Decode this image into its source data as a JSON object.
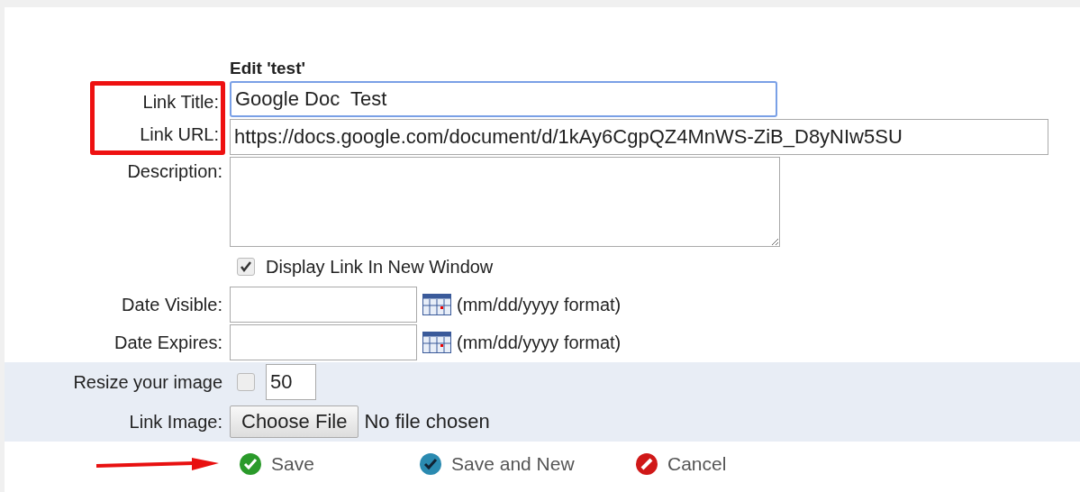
{
  "heading": "Edit 'test'",
  "highlighted_labels": [
    "Link Title:",
    "Link URL:"
  ],
  "link_title": {
    "value": "Google Doc  Test",
    "focused": true
  },
  "link_url": {
    "value": "https://docs.google.com/document/d/1kAy6CgpQZ4MnWS-ZiB_D8yNIw5SU"
  },
  "description": {
    "label": "Description:"
  },
  "new_window": {
    "label": "Display Link In New Window",
    "checked": true
  },
  "dates": [
    {
      "label": "Date Visible:",
      "hint": "(mm/dd/yyyy format)"
    },
    {
      "label": "Date Expires:",
      "hint": "(mm/dd/yyyy format)"
    }
  ],
  "resize": {
    "label": "Resize your image",
    "checked": false,
    "value": "50"
  },
  "link_image": {
    "label": "Link Image:",
    "button": "Choose File",
    "status": "No file chosen"
  },
  "save_arrow": true,
  "actions": [
    {
      "kind": "save",
      "label": "Save"
    },
    {
      "kind": "save_new",
      "label": "Save and New"
    },
    {
      "kind": "cancel",
      "label": "Cancel"
    }
  ]
}
